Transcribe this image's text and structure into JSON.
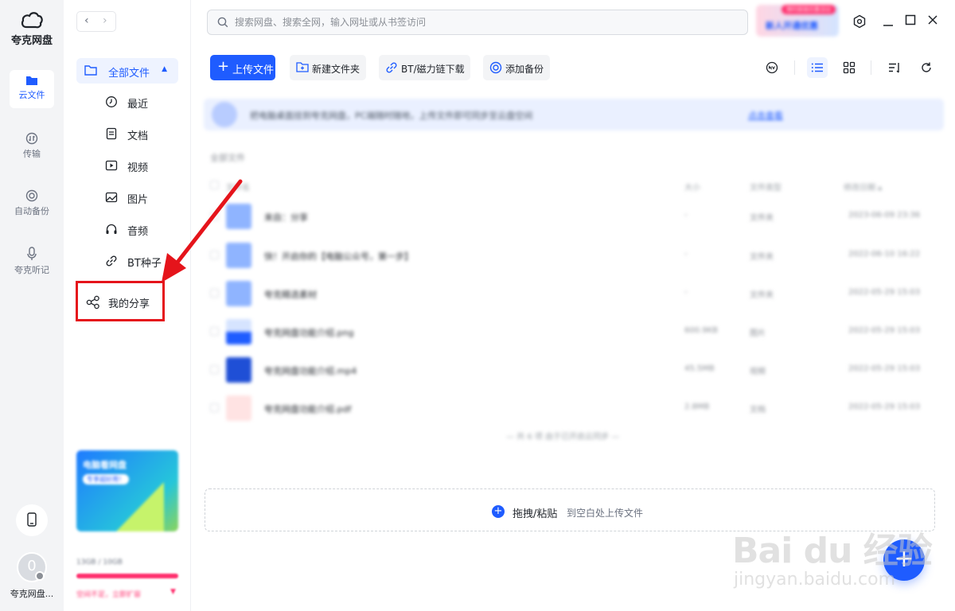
{
  "app": {
    "name": "夸克网盘"
  },
  "rail": {
    "items": [
      {
        "label": "云文件",
        "icon": "cloud-folder-icon",
        "active": true
      },
      {
        "label": "传输",
        "icon": "transfer-icon"
      },
      {
        "label": "自动备份",
        "icon": "backup-icon"
      },
      {
        "label": "夸克听记",
        "icon": "microphone-icon"
      }
    ],
    "user_name": "夸克网盘...",
    "avatar_initial": "0"
  },
  "nav": {
    "back": "‹",
    "forward": "›",
    "all_files": "全部文件",
    "sub_items": [
      {
        "label": "最近",
        "icon": "clock-icon"
      },
      {
        "label": "文档",
        "icon": "document-icon"
      },
      {
        "label": "视频",
        "icon": "video-icon"
      },
      {
        "label": "图片",
        "icon": "image-icon"
      },
      {
        "label": "音频",
        "icon": "headphones-icon"
      },
      {
        "label": "BT种子",
        "icon": "link-icon"
      }
    ],
    "my_share": "我的分享",
    "promo_title": "电脑看网盘",
    "promo_tag": "专享超好用！",
    "quota_text": "13GB / 10GB",
    "quota_note": "空间不足，立即扩容"
  },
  "search": {
    "placeholder": "搜索网盘、搜索全网，输入网址或从书签访问"
  },
  "vip": {
    "tag": "限时超值优惠活动",
    "text": "新人开通优惠"
  },
  "toolbar": {
    "upload": "上传文件",
    "new_folder": "新建文件夹",
    "bt_download": "BT/磁力链下载",
    "add_backup": "添加备份"
  },
  "notice": {
    "text": "把电脑桌面挂到夸克网盘，PC端随时随地，上传文件即可同步至云盘空间",
    "link": "点击查看"
  },
  "files": {
    "section_title": "全部文件",
    "columns": {
      "name": "文件名",
      "size": "大小",
      "type": "文件类型",
      "modified": "修改日期 ▴"
    },
    "rows": [
      {
        "name": "来自：分享",
        "size": "-",
        "type": "文件夹",
        "date": "2023-06-09 23:36",
        "thumb": "folder"
      },
      {
        "name": "快！开启你的【电脑公众号，第一步】",
        "size": "-",
        "type": "文件夹",
        "date": "2022-06-10 16:22",
        "thumb": "folder"
      },
      {
        "name": "夸克精选素材",
        "size": "-",
        "type": "文件夹",
        "date": "2022-05-29 15:03",
        "thumb": "folder"
      },
      {
        "name": "夸克网盘功能介绍.png",
        "size": "600.9KB",
        "type": "图片",
        "date": "2022-05-29 15:03",
        "thumb": "image"
      },
      {
        "name": "夸克网盘功能介绍.mp4",
        "size": "45.5MB",
        "type": "视频",
        "date": "2022-05-29 15:03",
        "thumb": "video"
      },
      {
        "name": "夸克网盘功能介绍.pdf",
        "size": "2.8MB",
        "type": "文档",
        "date": "2022-05-29 15:03",
        "thumb": "pdf"
      }
    ],
    "list_end": "— 共 6 项 由于已开启云同步 —"
  },
  "dropzone": {
    "main": "拖拽/粘贴",
    "sub": "到空白处上传文件"
  },
  "fab": "+",
  "watermark": {
    "brand": "Bai du 经验",
    "sub": "jingyan.baidu.com"
  },
  "colors": {
    "primary": "#1f5cff",
    "highlight": "#e5141b",
    "rail_bg": "#f3f4f6"
  }
}
